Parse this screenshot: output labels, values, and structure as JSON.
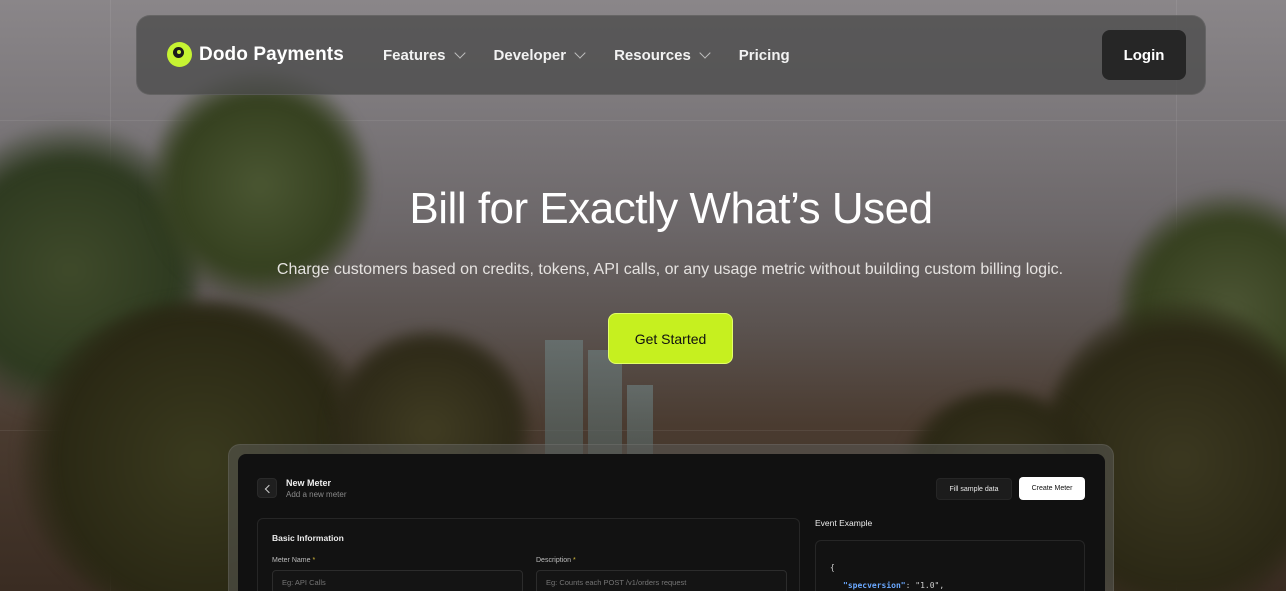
{
  "brand": {
    "name": "Dodo Payments",
    "icon": "dodo-logo-icon",
    "accent": "#c6f01f"
  },
  "nav": {
    "items": [
      {
        "label": "Features",
        "has_dropdown": true
      },
      {
        "label": "Developer",
        "has_dropdown": true
      },
      {
        "label": "Resources",
        "has_dropdown": true
      },
      {
        "label": "Pricing",
        "has_dropdown": false
      }
    ],
    "login_label": "Login"
  },
  "hero": {
    "title": "Bill for Exactly What’s Used",
    "subtitle": "Charge customers based on credits, tokens, API calls, or any usage metric without building custom billing logic.",
    "cta_label": "Get Started"
  },
  "preview": {
    "page_title": "New Meter",
    "page_subtitle": "Add a new meter",
    "fill_sample_label": "Fill sample data",
    "create_label": "Create Meter",
    "section_title": "Basic Information",
    "fields": [
      {
        "label": "Meter Name",
        "required_mark": "*",
        "placeholder": "Eg: API Calls"
      },
      {
        "label": "Description",
        "required_mark": "*",
        "placeholder": "Eg: Counts each POST /v1/orders request"
      }
    ],
    "event_example_label": "Event Example",
    "code": {
      "open_brace": "{",
      "key": "\"specversion\"",
      "rest": ": \"1.0\","
    }
  }
}
